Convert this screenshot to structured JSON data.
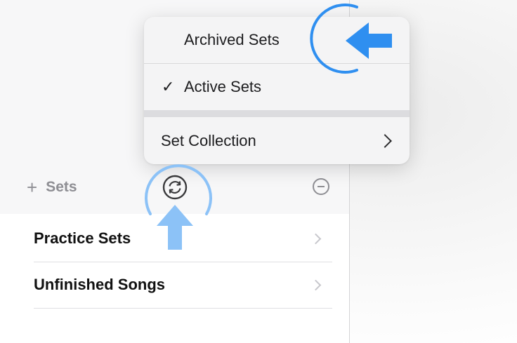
{
  "menu": {
    "archived_label": "Archived Sets",
    "active_check": "✓",
    "active_label": "Active Sets",
    "collection_label": "Set Collection"
  },
  "toolbar": {
    "add_symbol": "+",
    "add_label": "Sets"
  },
  "list": {
    "items": [
      {
        "label": "Practice Sets"
      },
      {
        "label": "Unfinished Songs"
      }
    ]
  },
  "colors": {
    "annotation": "#2f8ff0",
    "annotation_light": "#8cc2f7",
    "secondary_text": "#8e8e93"
  },
  "icons": [
    "sync-icon",
    "minus-circle-icon",
    "checkmark-icon",
    "chevron-right-icon",
    "plus-icon",
    "arrow-left-icon",
    "arrow-up-icon"
  ]
}
